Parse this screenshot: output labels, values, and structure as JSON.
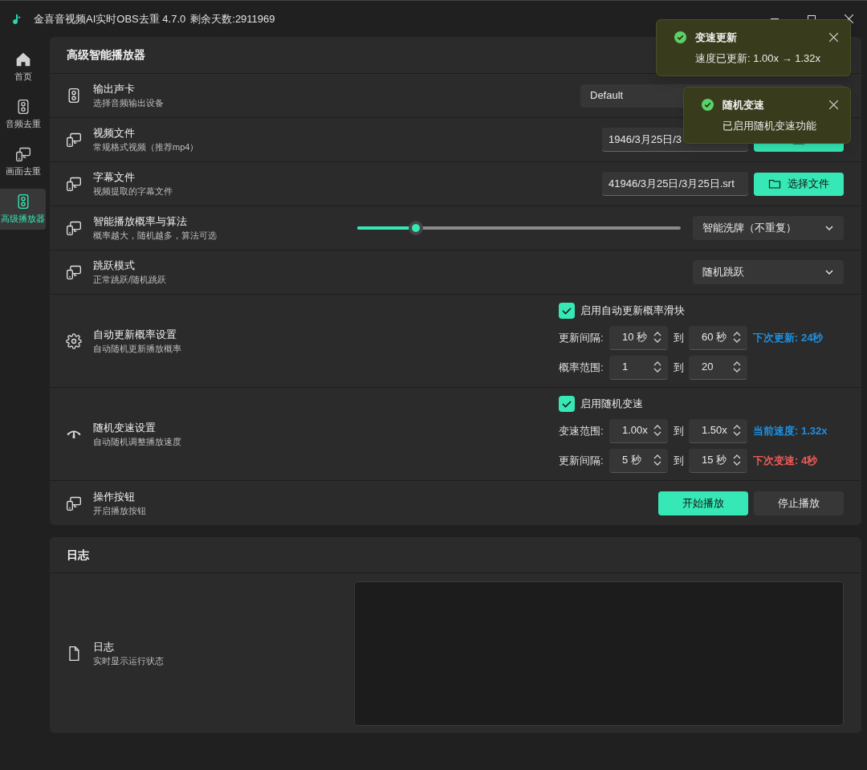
{
  "window": {
    "title": "金喜音视频AI实时OBS去重 4.7.0",
    "remaining": "剩余天数:2911969"
  },
  "sidebar": {
    "items": [
      {
        "label": "首页",
        "selected": false
      },
      {
        "label": "音频去重",
        "selected": false
      },
      {
        "label": "画面去重",
        "selected": false
      },
      {
        "label": "高级播放器",
        "selected": true
      }
    ]
  },
  "panel": {
    "title": "高级智能播放器",
    "rows": [
      {
        "kind": "output_device",
        "title": "输出声卡",
        "subtitle": "选择音频输出设备",
        "value": "Default"
      },
      {
        "kind": "file",
        "title": "视频文件",
        "subtitle": "常规格式视频（推荐mp4）",
        "path": "1946/3月25日/3"
      },
      {
        "kind": "file",
        "title": "字幕文件",
        "subtitle": "视频提取的字幕文件",
        "path": "41946/3月25日/3月25日.srt",
        "button": "选择文件"
      },
      {
        "kind": "slider",
        "title": "智能播放概率与算法",
        "subtitle": "概率越大，随机越多，算法可选",
        "level": 0.18,
        "value": "智能洗牌（不重复）"
      },
      {
        "kind": "select",
        "title": "跳跃模式",
        "subtitle": "正常跳跃/随机跳跃",
        "value": "随机跳跃"
      },
      {
        "kind": "auto_update",
        "title": "自动更新概率设置",
        "subtitle": "自动随机更新播放概率",
        "checkbox": {
          "label": "启用自动更新概率滑块",
          "checked": true
        },
        "lines": [
          {
            "label": "更新间隔:",
            "from": "10 秒",
            "to_label": "到",
            "to": "60 秒",
            "note": "下次更新: 24秒",
            "color": "#1e90e0"
          },
          {
            "label": "概率范围:",
            "from": "1",
            "to_label": "到",
            "to": "20"
          }
        ]
      },
      {
        "kind": "speed",
        "title": "随机变速设置",
        "subtitle": "自动随机调整播放速度",
        "checkbox": {
          "label": "启用随机变速",
          "checked": true
        },
        "lines": [
          {
            "label": "变速范围:",
            "from": "1.00x",
            "to_label": "到",
            "to": "1.50x",
            "note": "当前速度: 1.32x",
            "color": "#1e90e0"
          },
          {
            "label": "更新间隔:",
            "from": "5 秒",
            "to_label": "到",
            "to": "15 秒",
            "note": "下次变速: 4秒",
            "color": "#f05a5a"
          }
        ]
      },
      {
        "kind": "buttons",
        "title": "操作按钮",
        "subtitle": "开启播放按钮",
        "buttons": [
          {
            "label": "开始播放",
            "primary": true
          },
          {
            "label": "停止播放",
            "primary": false
          }
        ]
      }
    ]
  },
  "log": {
    "title": "日志",
    "row_title": "日志",
    "row_subtitle": "实时显示运行状态"
  },
  "toasts": [
    {
      "title": "变速更新",
      "message": "速度已更新: 1.00x → 1.32x"
    },
    {
      "title": "随机变速",
      "message": "已启用随机变速功能"
    }
  ]
}
